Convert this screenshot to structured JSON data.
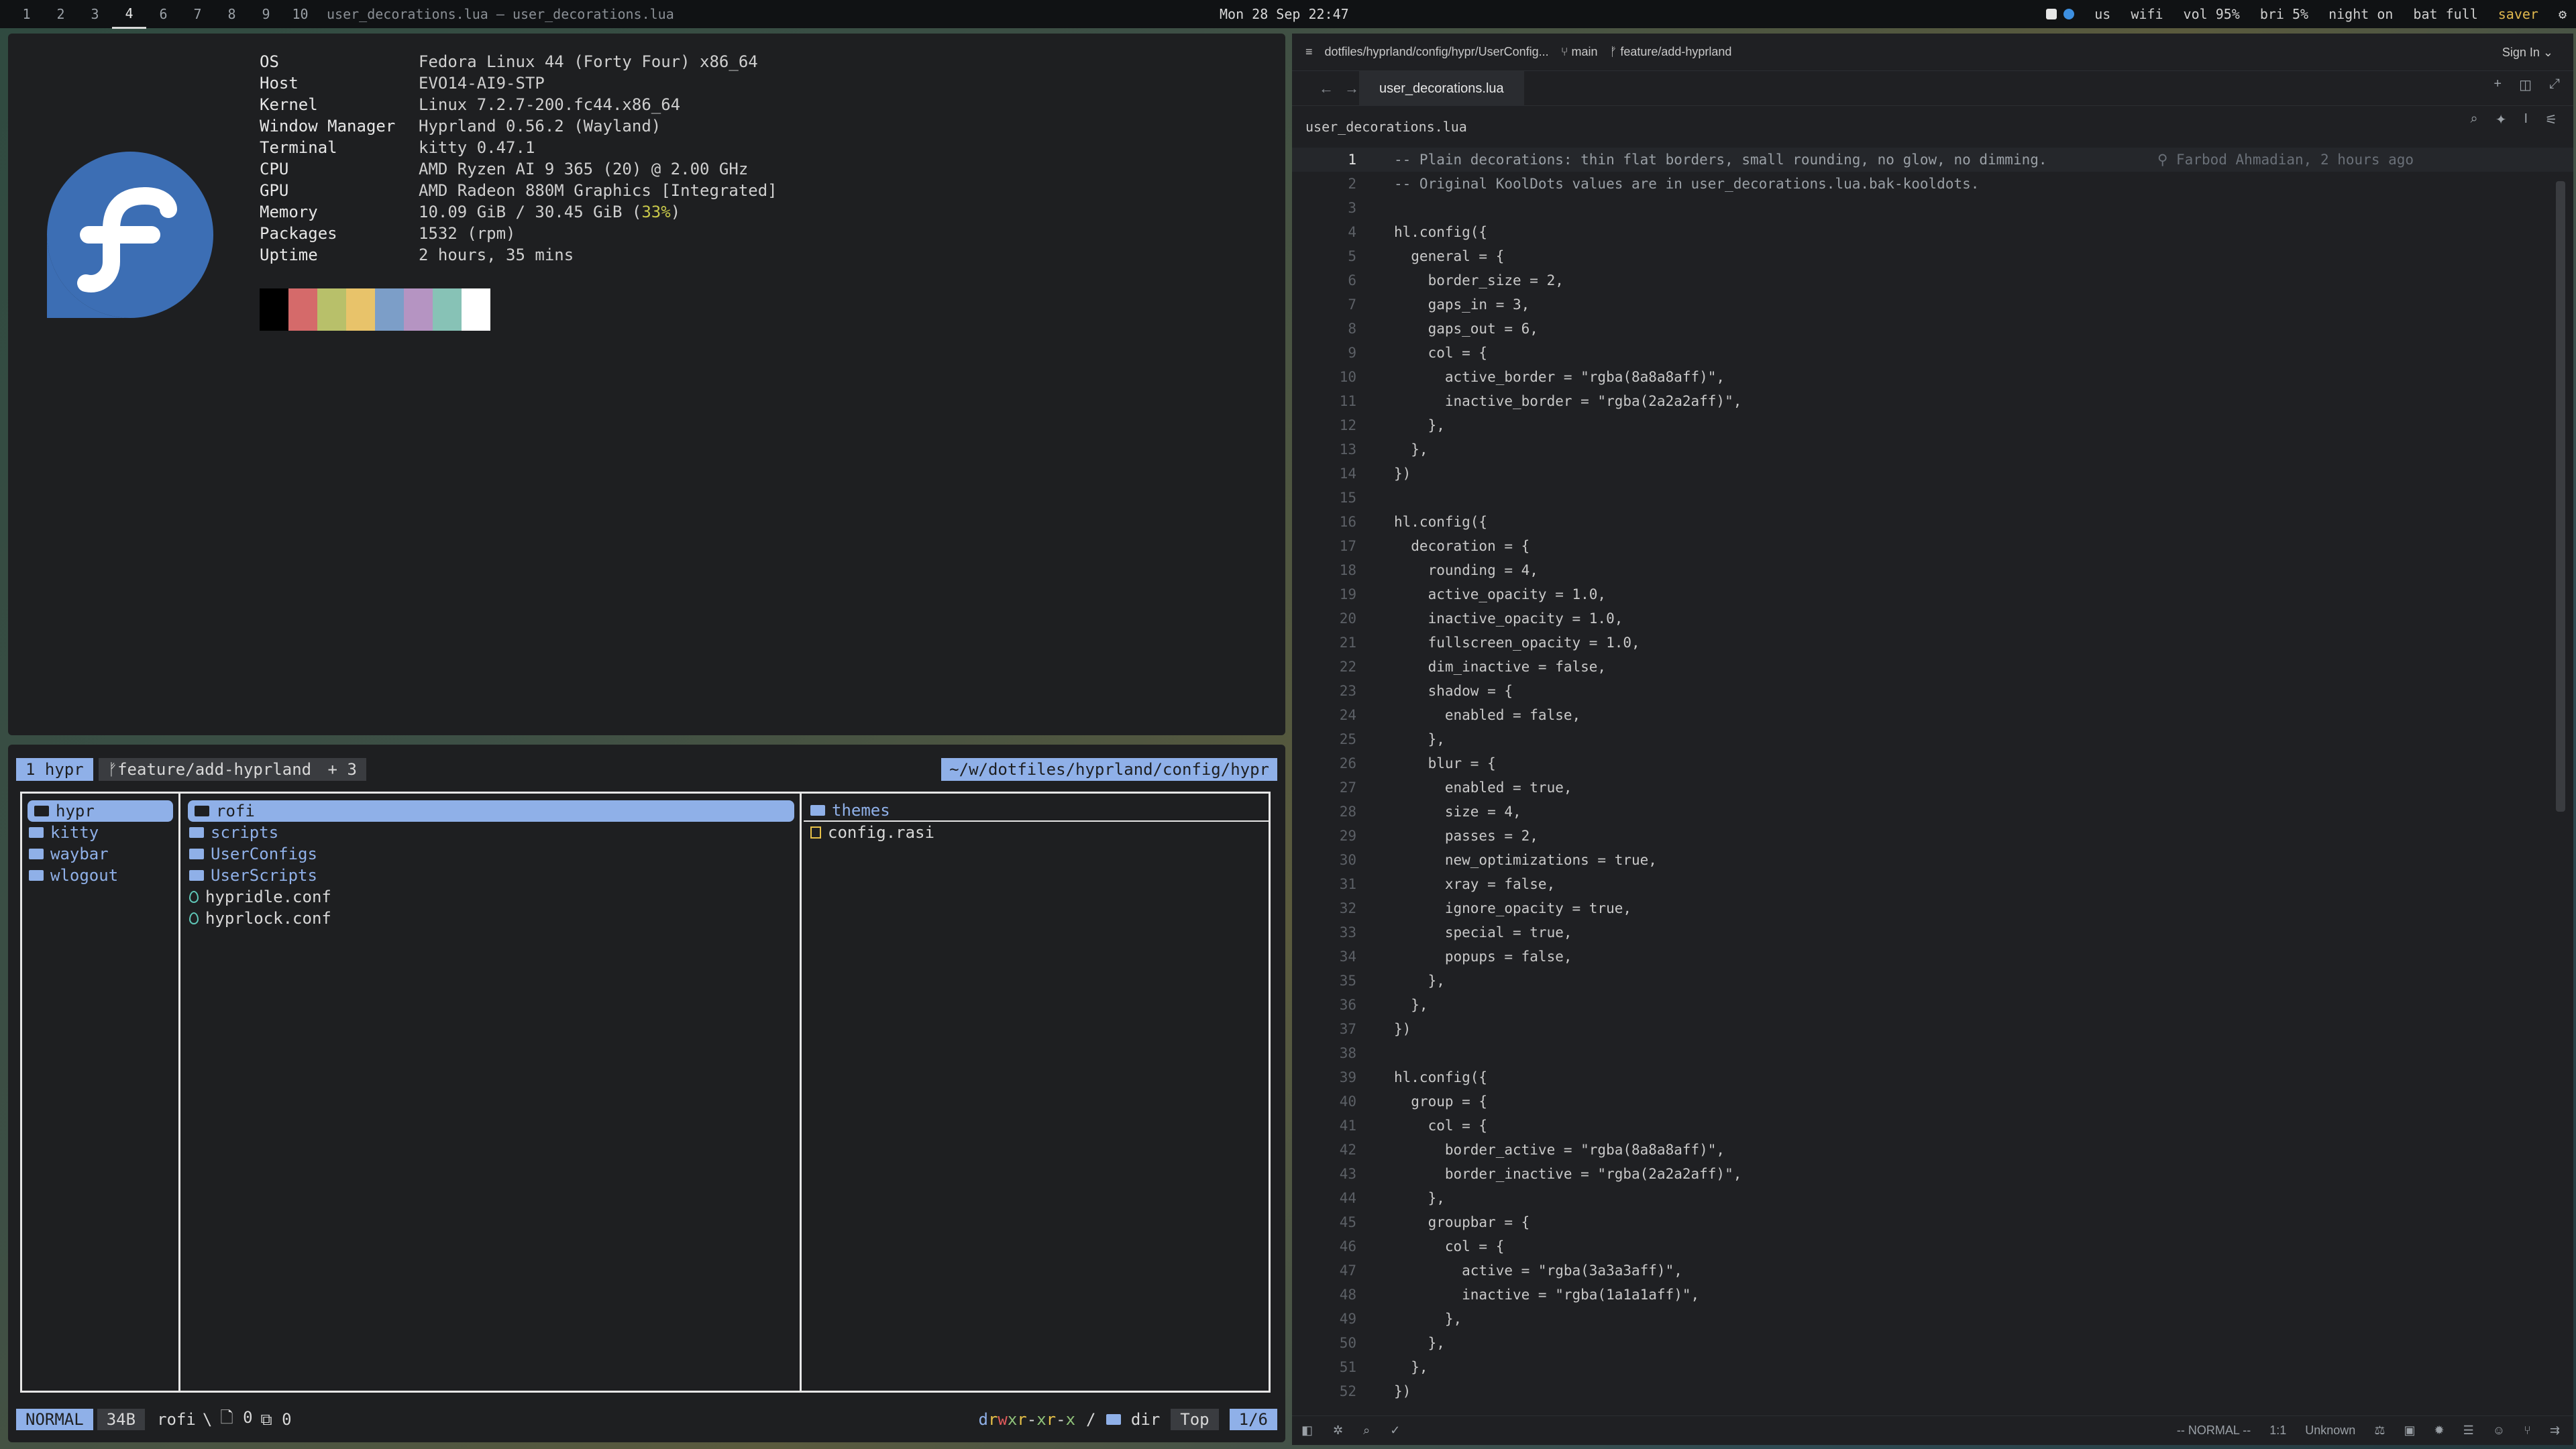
{
  "topbar": {
    "workspaces": [
      "1",
      "2",
      "3",
      "4",
      "6",
      "7",
      "8",
      "9",
      "10"
    ],
    "active_workspace": "4",
    "window_title": "user_decorations.lua — user_decorations.lua",
    "clock": "Mon 28 Sep  22:47",
    "lang": "us",
    "wifi": "wifi",
    "volume": "vol 95%",
    "brightness": "bri 5%",
    "night": "night on",
    "battery": "bat full",
    "saver": "saver",
    "power_icon": "power-icon"
  },
  "fetch": {
    "rows": [
      {
        "k": "OS",
        "v": "Fedora Linux 44 (Forty Four) x86_64"
      },
      {
        "k": "Host",
        "v": "EVO14-AI9-STP"
      },
      {
        "k": "Kernel",
        "v": "Linux 7.2.7-200.fc44.x86_64"
      },
      {
        "k": "Window Manager",
        "v": "Hyprland 0.56.2 (Wayland)"
      },
      {
        "k": "Terminal",
        "v": "kitty 0.47.1"
      },
      {
        "k": "CPU",
        "v": "AMD Ryzen AI 9 365 (20) @ 2.00 GHz"
      },
      {
        "k": "GPU",
        "v": "AMD Radeon 880M Graphics [Integrated]"
      },
      {
        "k": "Memory",
        "v": "10.09 GiB / 30.45 GiB (",
        "pct": "33%",
        "tail": ")"
      },
      {
        "k": "Packages",
        "v": "1532 (rpm)"
      },
      {
        "k": "Uptime",
        "v": "2 hours, 35 mins"
      }
    ],
    "palette": [
      "#000000",
      "#d56a6a",
      "#b8c06a",
      "#e8c36a",
      "#7c9ec8",
      "#b594c2",
      "#87c2b6",
      "#ffffff"
    ]
  },
  "yazi": {
    "tab": "1 hypr",
    "branch": "feature/add-hyprland",
    "branch_plus": "+ 3",
    "counts": {
      "eq": "0",
      "ok": "0",
      "err": "0"
    },
    "path": "~/w/dotfiles/hyprland/config/hypr",
    "parent": [
      "hypr",
      "kitty",
      "waybar",
      "wlogout"
    ],
    "current_dirs": [
      "rofi",
      "scripts",
      "UserConfigs",
      "UserScripts"
    ],
    "current_files": [
      "hypridle.conf",
      "hyprlock.conf"
    ],
    "preview_dirs": [
      "themes"
    ],
    "preview_files": [
      "config.rasi"
    ],
    "mode": "NORMAL",
    "size": "34B",
    "selected": "rofi",
    "files_count": "0",
    "links_count": "0",
    "perm": {
      "d": "d",
      "r1": "r",
      "w1": "w",
      "x1": "x",
      "r2": "r",
      "d2": "-",
      "x2": "x",
      "r3": "r",
      "d3": "-",
      "x3": "x"
    },
    "type": "dir",
    "scroll": "Top",
    "page": "1/6"
  },
  "editor": {
    "breadcrumb": "dotfiles/hyprland/config/hypr/UserConfig...",
    "branch_main": "main",
    "branch_feature": "feature/add-hyprland",
    "sign_in": "Sign In",
    "tab": "user_decorations.lua",
    "file_crumb": "user_decorations.lua",
    "blame": "Farbod Ahmadian, 2 hours ago",
    "lines": [
      "-- Plain decorations: thin flat borders, small rounding, no glow, no dimming.",
      "-- Original KoolDots values are in user_decorations.lua.bak-kooldots.",
      "",
      "hl.config({",
      "  general = {",
      "    border_size = 2,",
      "    gaps_in = 3,",
      "    gaps_out = 6,",
      "    col = {",
      "      active_border = \"rgba(8a8a8aff)\",",
      "      inactive_border = \"rgba(2a2a2aff)\",",
      "    },",
      "  },",
      "})",
      "",
      "hl.config({",
      "  decoration = {",
      "    rounding = 4,",
      "    active_opacity = 1.0,",
      "    inactive_opacity = 1.0,",
      "    fullscreen_opacity = 1.0,",
      "    dim_inactive = false,",
      "    shadow = {",
      "      enabled = false,",
      "    },",
      "    blur = {",
      "      enabled = true,",
      "      size = 4,",
      "      passes = 2,",
      "      new_optimizations = true,",
      "      xray = false,",
      "      ignore_opacity = true,",
      "      special = true,",
      "      popups = false,",
      "    },",
      "  },",
      "})",
      "",
      "hl.config({",
      "  group = {",
      "    col = {",
      "      border_active = \"rgba(8a8a8aff)\",",
      "      border_inactive = \"rgba(2a2a2aff)\",",
      "    },",
      "    groupbar = {",
      "      col = {",
      "        active = \"rgba(3a3a3aff)\",",
      "        inactive = \"rgba(1a1a1aff)\",",
      "      },",
      "    },",
      "  },",
      "})"
    ],
    "status_mode": "-- NORMAL --",
    "status_pos": "1:1",
    "status_enc": "Unknown"
  }
}
